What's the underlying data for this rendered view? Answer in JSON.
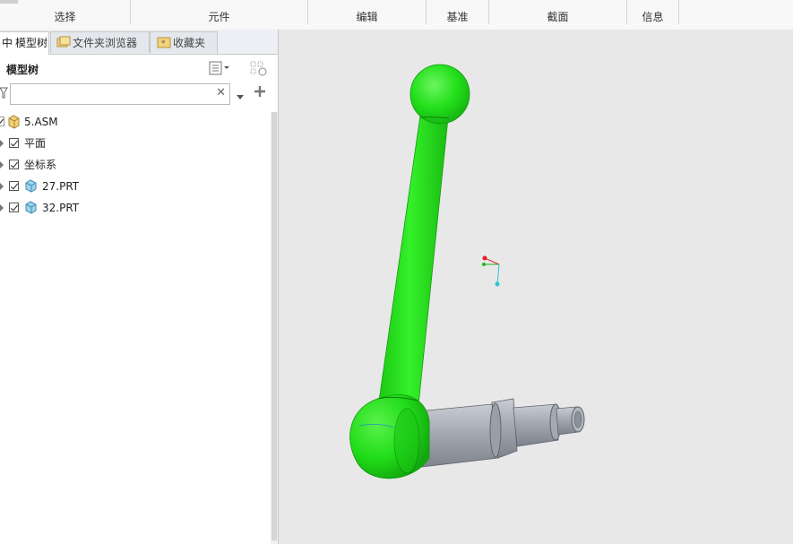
{
  "ribbon": {
    "groups": [
      "选择",
      "元件",
      "编辑",
      "基准",
      "截面",
      "信息"
    ]
  },
  "panel": {
    "tabs": [
      {
        "label": "模型树",
        "prefix": "中",
        "icon": "model-tree-icon"
      },
      {
        "label": "文件夹浏览器",
        "icon": "folder-browser-icon"
      },
      {
        "label": "收藏夹",
        "icon": "favorites-icon"
      }
    ],
    "tree_title": "模型树",
    "search": {
      "value": "",
      "placeholder": ""
    },
    "clear_symbol": "✕"
  },
  "tree": {
    "items": [
      {
        "label": "5.ASM",
        "icon": "assembly-icon",
        "checkbox": false
      },
      {
        "label": "平面",
        "icon": "",
        "checkbox": true
      },
      {
        "label": "坐标系",
        "icon": "",
        "checkbox": true
      },
      {
        "label": "27.PRT",
        "icon": "part-icon",
        "checkbox": true
      },
      {
        "label": "32.PRT",
        "icon": "part-icon",
        "checkbox": true
      }
    ]
  },
  "colors": {
    "handle": "#22e01a",
    "shaft": "#9aa0aa",
    "viewport_bg": "#e8e8e8"
  }
}
